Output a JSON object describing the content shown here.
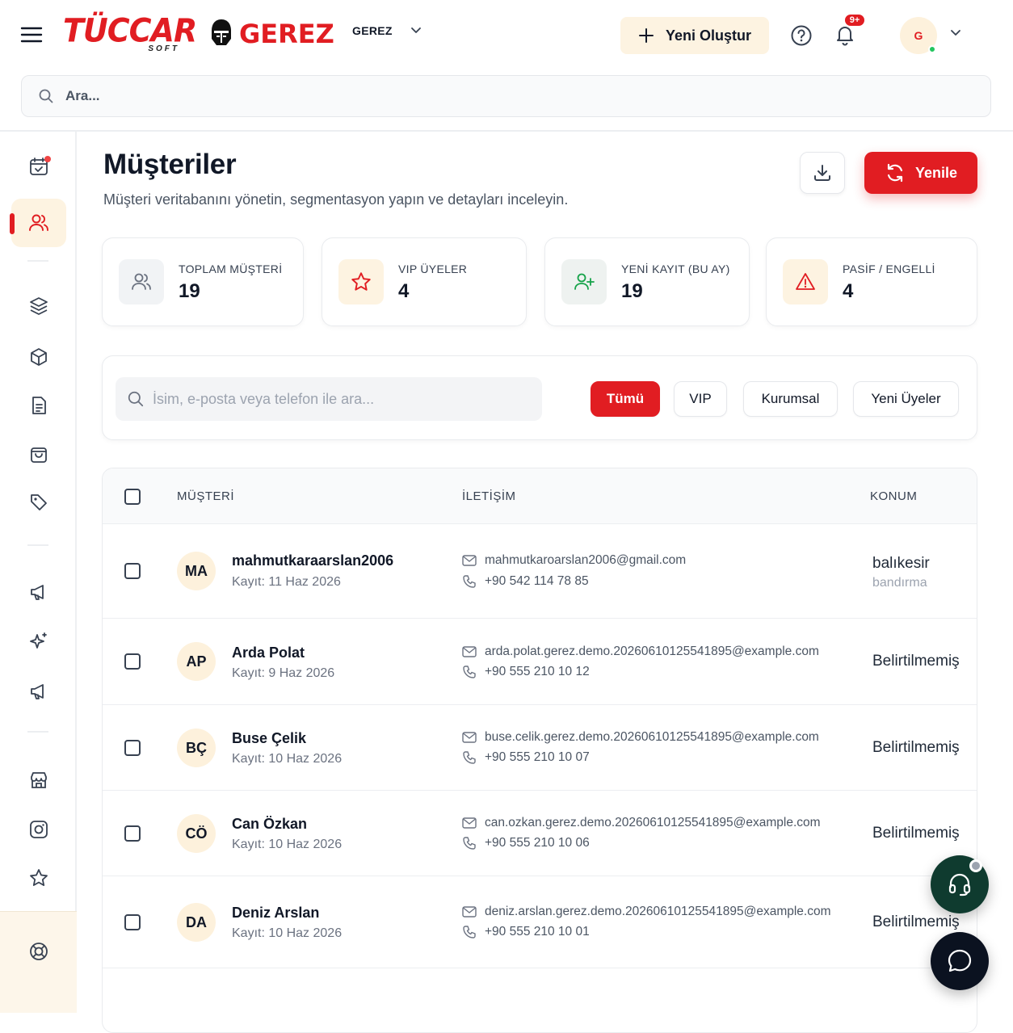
{
  "header": {
    "brand_primary": "TÜCCAR",
    "brand_primary_sub": "SOFT",
    "brand_secondary": "GEREZ",
    "company_label": "GEREZ",
    "create_label": "Yeni Oluştur",
    "notification_badge": "9+",
    "avatar_initial": "G",
    "search_placeholder": "Ara..."
  },
  "sidebar": {
    "items": [
      {
        "icon": "calendar-check-icon"
      },
      {
        "icon": "users-icon",
        "active": true
      },
      {
        "icon": "layers-icon"
      },
      {
        "icon": "box-icon"
      },
      {
        "icon": "file-list-icon"
      },
      {
        "icon": "shopping-bag-icon"
      },
      {
        "icon": "tag-icon"
      },
      {
        "icon": "megaphone-icon"
      },
      {
        "icon": "sparkles-icon"
      },
      {
        "icon": "megaphone-icon"
      },
      {
        "icon": "store-icon"
      },
      {
        "icon": "instagram-icon"
      },
      {
        "icon": "star-icon"
      },
      {
        "icon": "lifebuoy-icon"
      }
    ]
  },
  "page": {
    "title": "Müşteriler",
    "subtitle": "Müşteri veritabanını yönetin, segmentasyon yapın ve detayları inceleyin.",
    "refresh_label": "Yenile"
  },
  "stats": [
    {
      "label": "TOPLAM MÜŞTERİ",
      "value": "19",
      "icon": "users-icon"
    },
    {
      "label": "VIP ÜYELER",
      "value": "4",
      "icon": "star-icon"
    },
    {
      "label": "YENİ KAYIT (BU AY)",
      "value": "19",
      "icon": "user-plus-icon"
    },
    {
      "label": "PASİF / ENGELLİ",
      "value": "4",
      "icon": "warning-icon"
    }
  ],
  "filters": {
    "search_placeholder": "İsim, e-posta veya telefon ile ara...",
    "chips": [
      "Tümü",
      "VIP",
      "Kurumsal",
      "Yeni Üyeler"
    ],
    "active_chip": "Tümü"
  },
  "table": {
    "columns": [
      "MÜŞTERİ",
      "İLETİŞİM",
      "KONUM"
    ],
    "rows": [
      {
        "initials": "MA",
        "name": "mahmutkaraarslan2006",
        "registered": "Kayıt: 11 Haz 2026",
        "email": "mahmutkaroarslan2006@gmail.com",
        "phone": "+90 542 114 78 85",
        "location": "balıkesir",
        "sublocation": "bandırma"
      },
      {
        "initials": "AP",
        "name": "Arda Polat",
        "registered": "Kayıt: 9 Haz 2026",
        "email": "arda.polat.gerez.demo.20260610125541895@example.com",
        "phone": "+90 555 210 10 12",
        "location": "Belirtilmemiş",
        "sublocation": ""
      },
      {
        "initials": "BÇ",
        "name": "Buse Çelik",
        "registered": "Kayıt: 10 Haz 2026",
        "email": "buse.celik.gerez.demo.20260610125541895@example.com",
        "phone": "+90 555 210 10 07",
        "location": "Belirtilmemiş",
        "sublocation": ""
      },
      {
        "initials": "CÖ",
        "name": "Can Özkan",
        "registered": "Kayıt: 10 Haz 2026",
        "email": "can.ozkan.gerez.demo.20260610125541895@example.com",
        "phone": "+90 555 210 10 06",
        "location": "Belirtilmemiş",
        "sublocation": ""
      },
      {
        "initials": "DA",
        "name": "Deniz Arslan",
        "registered": "Kayıt: 10 Haz 2026",
        "email": "deniz.arslan.gerez.demo.20260610125541895@example.com",
        "phone": "+90 555 210 10 01",
        "location": "Belirtilmemiş",
        "sublocation": ""
      }
    ]
  },
  "colors": {
    "accent": "#e11d22",
    "accent_soft": "#fdf3e1",
    "support_fab": "#0f3b2f",
    "chat_fab": "#0b1220",
    "online": "#22c55e"
  }
}
